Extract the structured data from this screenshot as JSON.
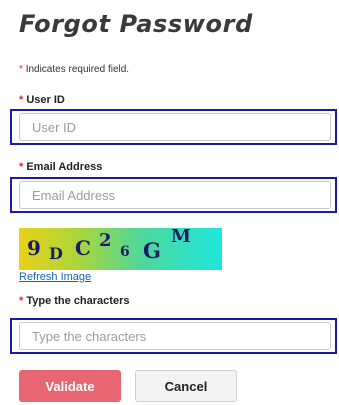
{
  "form": {
    "title": "Forgot Password",
    "required_note": "Indicates required field.",
    "required_marker": "*"
  },
  "fields": {
    "user_id": {
      "label": "User ID",
      "placeholder": "User ID",
      "value": ""
    },
    "email": {
      "label": "Email Address",
      "placeholder": "Email Address",
      "value": ""
    },
    "captcha": {
      "label": "Type the characters",
      "placeholder": "Type the characters",
      "value": ""
    }
  },
  "captcha_image": {
    "characters": [
      "9",
      "D",
      "C",
      "2",
      "6",
      "G",
      "M"
    ],
    "refresh_label": "Refresh Image"
  },
  "buttons": {
    "validate_label": "Validate",
    "cancel_label": "Cancel"
  },
  "colors": {
    "focus_frame": "#1a1aa8",
    "required_star": "#d42a2a",
    "validate_bg": "#e86672",
    "link": "#1a62b8"
  }
}
